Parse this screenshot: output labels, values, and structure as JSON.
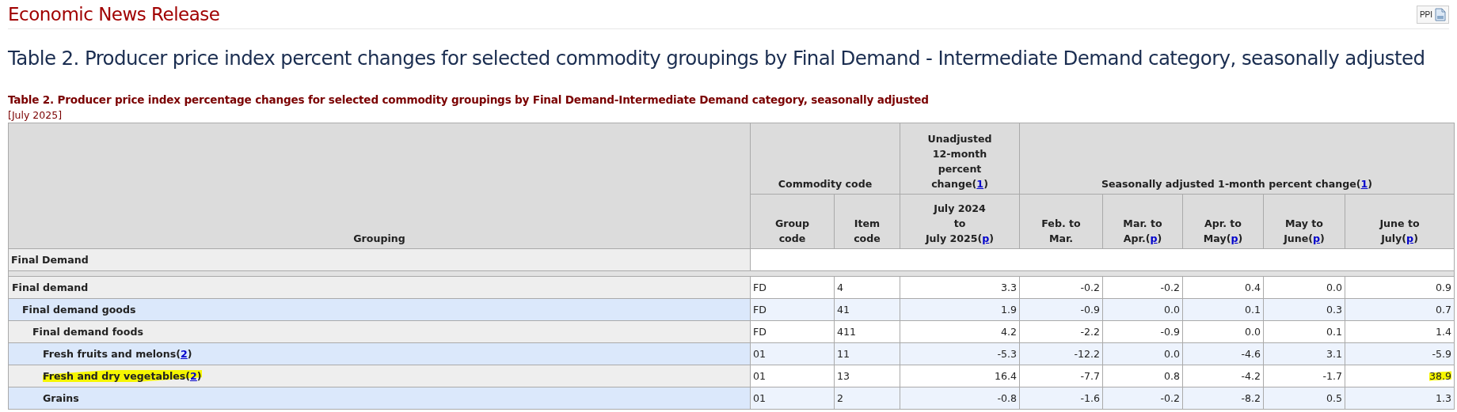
{
  "page_title": "Economic News Release",
  "badge": {
    "label": "PPI"
  },
  "heading": "Table 2. Producer price index percent changes for selected commodity groupings by Final Demand - Intermediate Demand category, seasonally adjusted",
  "table": {
    "caption": "Table 2. Producer price index percentage changes for selected commodity groupings by Final Demand-Intermediate Demand category, seasonally adjusted",
    "period": "[July 2025]",
    "columns": {
      "grouping": {
        "lines": [
          "Grouping"
        ]
      },
      "commodity_code": {
        "lines": [
          "Commodity code"
        ]
      },
      "unadjusted": {
        "lines": [
          "Unadjusted",
          "12-month",
          "percent",
          "change"
        ],
        "note": {
          "open": "(",
          "ref": "1",
          "close": ")"
        }
      },
      "seasonally_adjusted": {
        "lines": [
          "Seasonally adjusted 1-month percent change"
        ],
        "note": {
          "open": "(",
          "ref": "1",
          "close": ")"
        }
      },
      "subcolumns": [
        {
          "lines": [
            "Group",
            "code"
          ]
        },
        {
          "lines": [
            "Item",
            "code"
          ]
        },
        {
          "lines": [
            "July 2024",
            "to",
            "July 2025"
          ],
          "note": {
            "open": "(",
            "ref": "p",
            "close": ")"
          }
        },
        {
          "lines": [
            "Feb. to",
            "Mar."
          ]
        },
        {
          "lines": [
            "Mar. to",
            "Apr."
          ],
          "note": {
            "open": "(",
            "ref": "p",
            "close": ")"
          }
        },
        {
          "lines": [
            "Apr. to",
            "May"
          ],
          "note": {
            "open": "(",
            "ref": "p",
            "close": ")"
          }
        },
        {
          "lines": [
            "May to",
            "June"
          ],
          "note": {
            "open": "(",
            "ref": "p",
            "close": ")"
          }
        },
        {
          "lines": [
            "June to",
            "July"
          ],
          "note": {
            "open": "(",
            "ref": "p",
            "close": ")"
          }
        }
      ]
    },
    "section": "Final Demand",
    "rows": [
      {
        "label": "Final demand",
        "group_code": "FD",
        "item_code": "4",
        "values": [
          "3.3",
          "-0.2",
          "-0.2",
          "0.4",
          "0.0",
          "0.9"
        ],
        "highlighted": false,
        "children": [
          {
            "label": "Final demand goods",
            "group_code": "FD",
            "item_code": "41",
            "values": [
              "1.9",
              "-0.9",
              "0.0",
              "0.1",
              "0.3",
              "0.7"
            ],
            "highlighted": false,
            "children": [
              {
                "label": "Final demand foods",
                "group_code": "FD",
                "item_code": "411",
                "values": [
                  "4.2",
                  "-2.2",
                  "-0.9",
                  "0.0",
                  "0.1",
                  "1.4"
                ],
                "highlighted": false,
                "children": [
                  {
                    "label": "Fresh fruits and melons",
                    "note": {
                      "open": "(",
                      "ref": "2",
                      "close": ")"
                    },
                    "group_code": "01",
                    "item_code": "11",
                    "values": [
                      "-5.3",
                      "-12.2",
                      "0.0",
                      "-4.6",
                      "3.1",
                      "-5.9"
                    ],
                    "highlighted": false
                  },
                  {
                    "label": "Fresh and dry vegetables",
                    "note": {
                      "open": "(",
                      "ref": "2",
                      "close": ")"
                    },
                    "group_code": "01",
                    "item_code": "13",
                    "values": [
                      "16.4",
                      "-7.7",
                      "0.8",
                      "-4.2",
                      "-1.7",
                      "38.9"
                    ],
                    "highlighted": true
                  },
                  {
                    "label": "Grains",
                    "group_code": "01",
                    "item_code": "2",
                    "values": [
                      "-0.8",
                      "-1.6",
                      "-0.2",
                      "-8.2",
                      "0.5",
                      "1.3"
                    ],
                    "highlighted": false
                  }
                ]
              }
            ]
          }
        ]
      }
    ]
  }
}
